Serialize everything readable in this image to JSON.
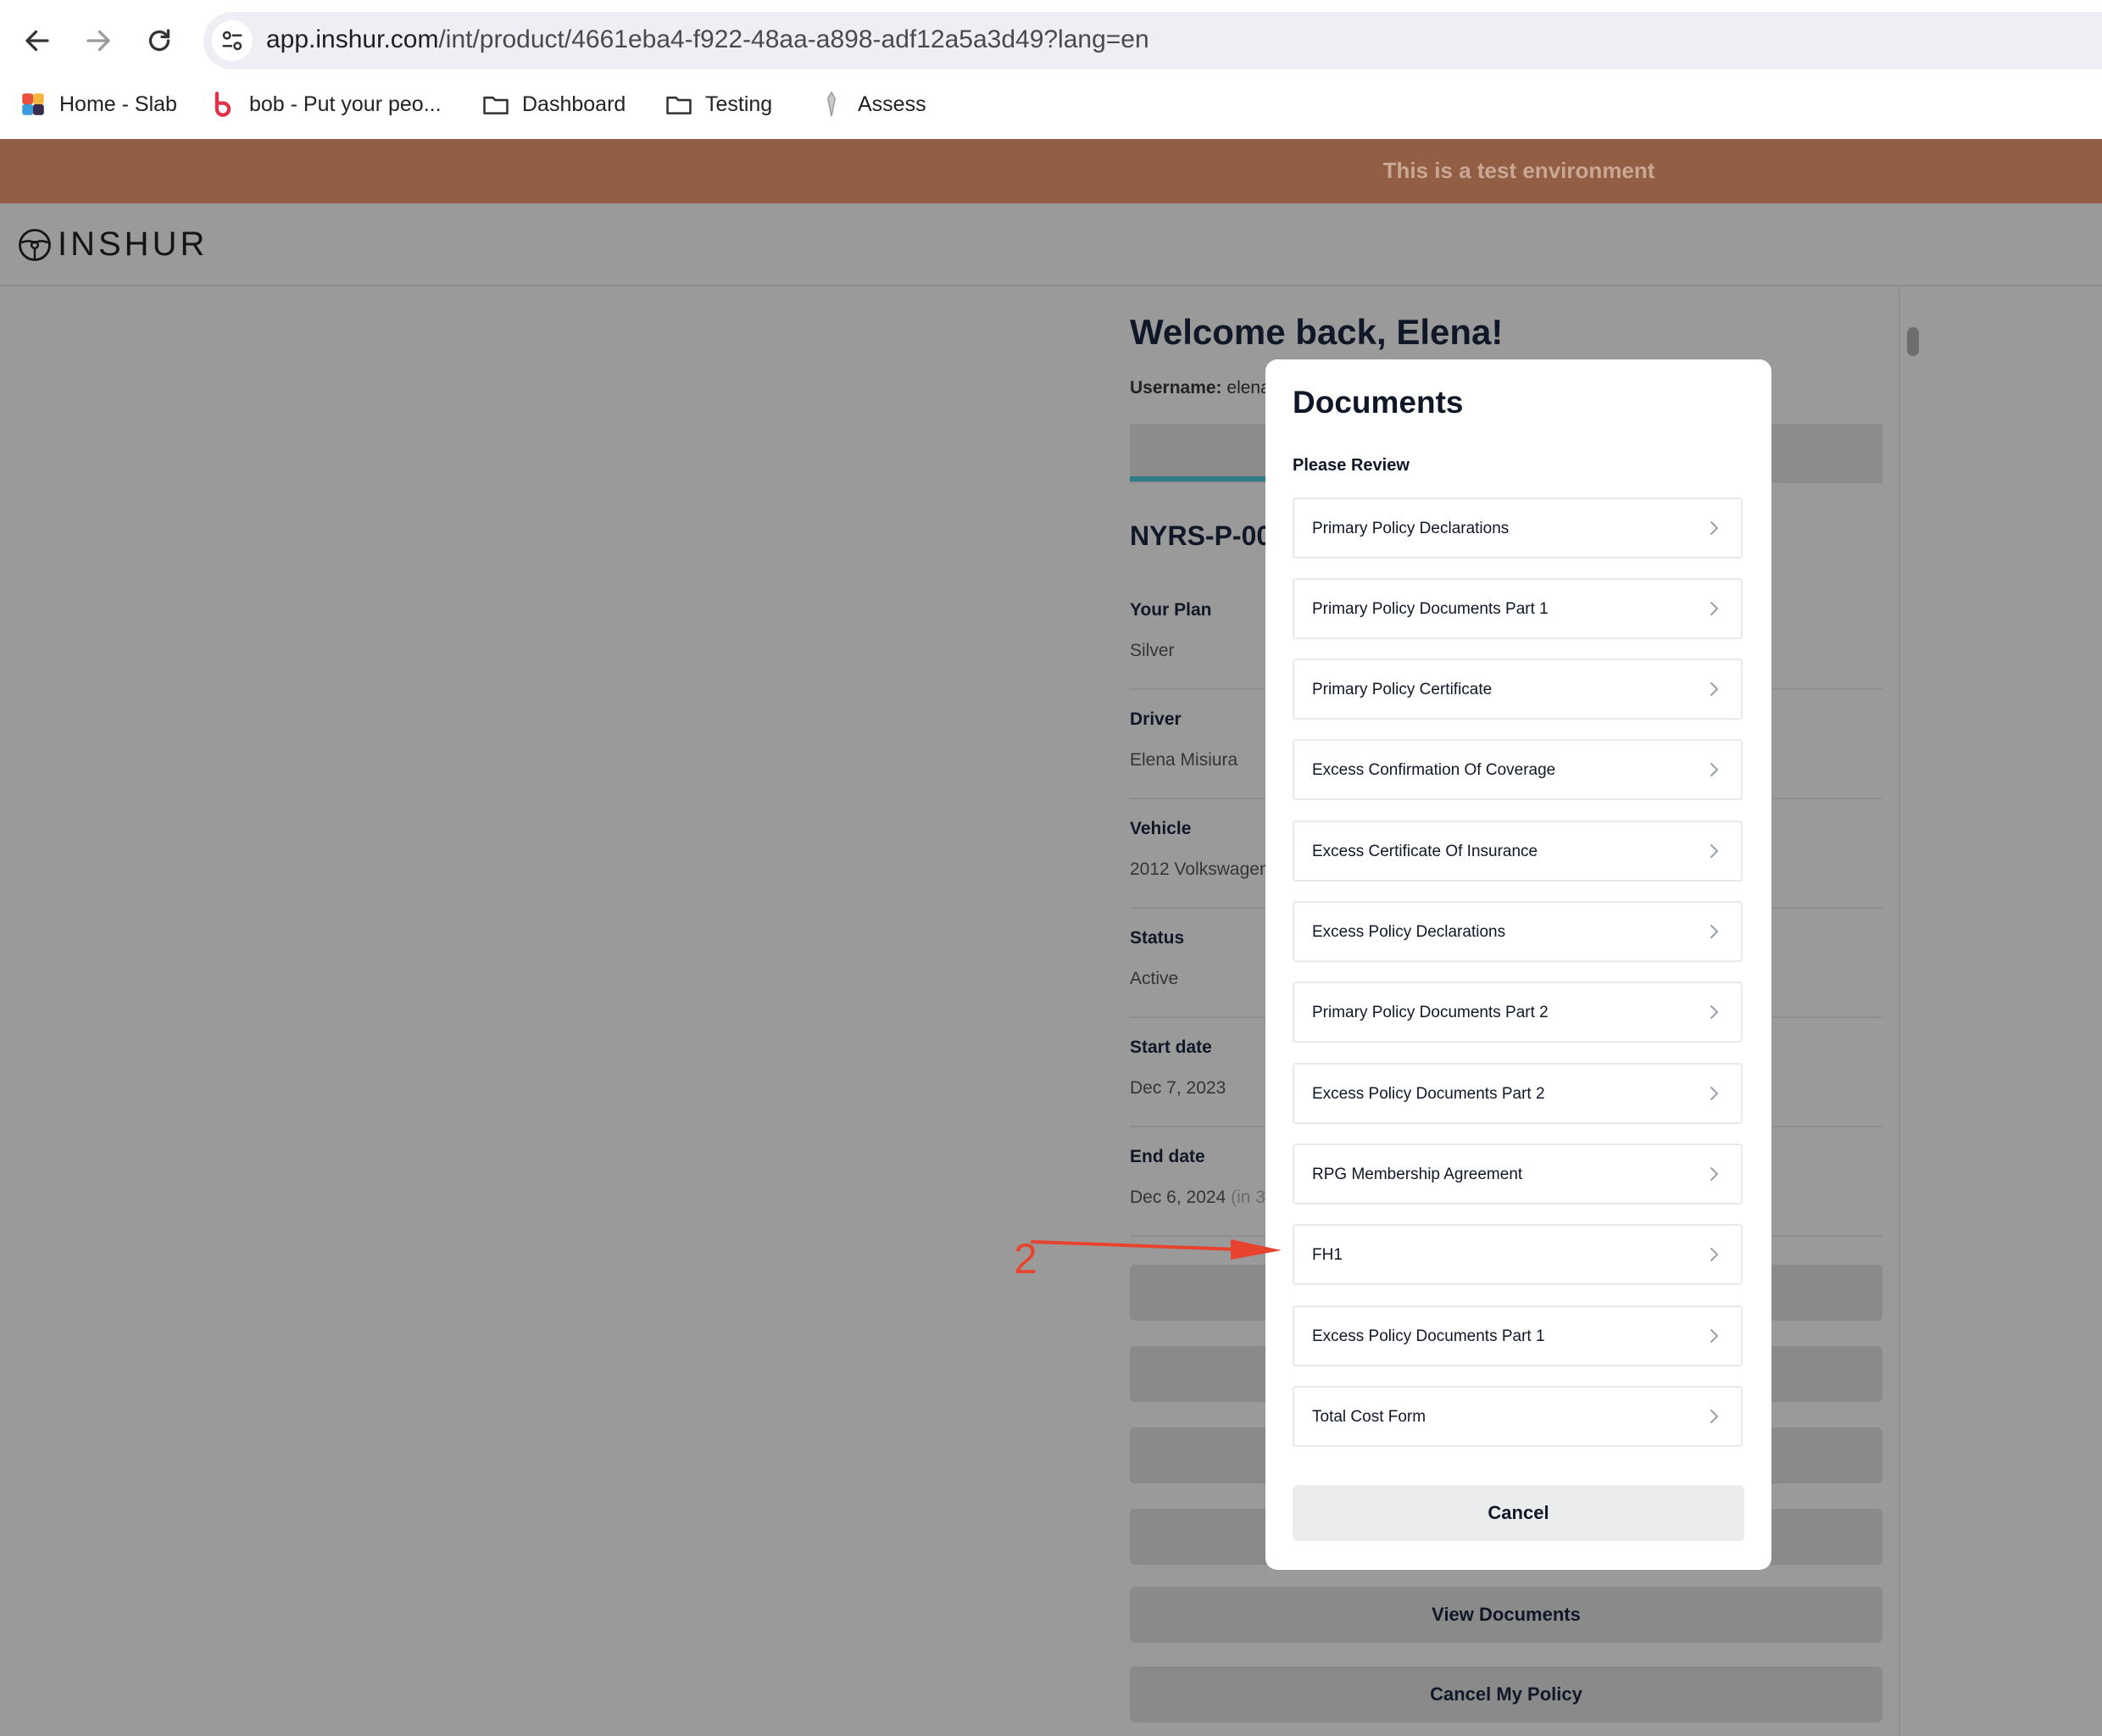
{
  "browser": {
    "url_host": "app.inshur.com",
    "url_path": "/int/product/4661eba4-f922-48aa-a898-adf12a5a3d49?lang=en",
    "bookmarks": [
      {
        "label": "Home - Slab"
      },
      {
        "label": "bob - Put your peo..."
      },
      {
        "label": "Dashboard"
      },
      {
        "label": "Testing"
      },
      {
        "label": "Assess"
      }
    ]
  },
  "banner": {
    "text": "This is a test environment"
  },
  "header": {
    "logo_text": "INSHUR"
  },
  "main": {
    "welcome": "Welcome back, Elena!",
    "username_label": "Username:",
    "username_value": "elena",
    "policy_id": "NYRS-P-00",
    "fields": [
      {
        "label": "Your Plan",
        "value": "Silver",
        "suffix": ""
      },
      {
        "label": "Driver",
        "value": "Elena Misiura",
        "suffix": ""
      },
      {
        "label": "Vehicle",
        "value": "2012 Volkswagen",
        "suffix": ""
      },
      {
        "label": "Status",
        "value": "Active",
        "suffix": ""
      },
      {
        "label": "Start date",
        "value": "Dec 7, 2023",
        "suffix": ""
      },
      {
        "label": "End date",
        "value": "Dec 6, 2024",
        "suffix": "(in 3"
      }
    ],
    "buttons": {
      "view_documents": "View Documents",
      "cancel_policy": "Cancel My Policy"
    }
  },
  "modal": {
    "title": "Documents",
    "subtitle": "Please Review",
    "documents": [
      "Primary Policy Declarations",
      "Primary Policy Documents Part 1",
      "Primary Policy Certificate",
      "Excess Confirmation Of Coverage",
      "Excess Certificate Of Insurance",
      "Excess Policy Declarations",
      "Primary Policy Documents Part 2",
      "Excess Policy Documents Part 2",
      "RPG Membership Agreement",
      "FH1",
      "Excess Policy Documents Part 1",
      "Total Cost Form"
    ],
    "cancel_label": "Cancel"
  },
  "annotation": {
    "label": "2",
    "color": "#e8432e"
  },
  "colors": {
    "banner": "#935f44",
    "accent": "#2f7b86",
    "overlay": "#9a9a9a"
  }
}
